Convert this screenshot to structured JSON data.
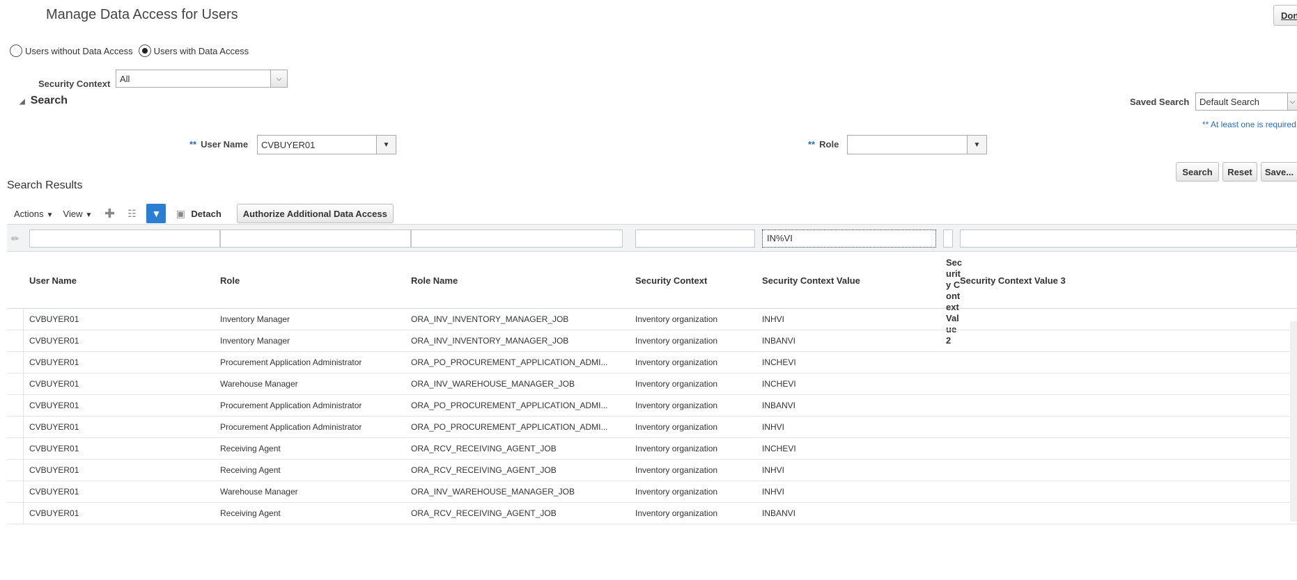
{
  "page": {
    "title": "Manage Data Access for Users",
    "done_label": "Done"
  },
  "mode": {
    "options": [
      {
        "label": "Users without Data Access",
        "selected": false
      },
      {
        "label": "Users with Data Access",
        "selected": true
      }
    ]
  },
  "security_context": {
    "label": "Security Context",
    "value": "All"
  },
  "search": {
    "title": "Search",
    "saved_search_label": "Saved Search",
    "saved_search_value": "Default Search",
    "required_hint": "** At least one is required",
    "required_marker": "**",
    "user_name_label": "User Name",
    "user_name_value": "CVBUYER01",
    "role_label": "Role",
    "role_value": "",
    "buttons": {
      "search": "Search",
      "reset": "Reset",
      "save": "Save..."
    }
  },
  "results": {
    "title": "Search Results",
    "toolbar": {
      "actions": "Actions",
      "view": "View",
      "detach": "Detach",
      "authorize": "Authorize Additional Data Access"
    },
    "filters": {
      "user_name": "",
      "role": "",
      "role_name": "",
      "security_context": "",
      "security_context_value": "IN%VI",
      "security_context_value_2": "",
      "security_context_value_3": ""
    },
    "columns": {
      "user_name": "User Name",
      "role": "Role",
      "role_name": "Role Name",
      "security_context": "Security Context",
      "security_context_value": "Security Context Value",
      "security_context_value_2": "Security Context Value 2",
      "security_context_value_3": "Security Context Value 3"
    },
    "rows": [
      {
        "user": "CVBUYER01",
        "role": "Inventory Manager",
        "role_name": "ORA_INV_INVENTORY_MANAGER_JOB",
        "context": "Inventory organization",
        "value": "INHVI"
      },
      {
        "user": "CVBUYER01",
        "role": "Inventory Manager",
        "role_name": "ORA_INV_INVENTORY_MANAGER_JOB",
        "context": "Inventory organization",
        "value": "INBANVI"
      },
      {
        "user": "CVBUYER01",
        "role": "Procurement Application Administrator",
        "role_name": "ORA_PO_PROCUREMENT_APPLICATION_ADMI...",
        "context": "Inventory organization",
        "value": "INCHEVI"
      },
      {
        "user": "CVBUYER01",
        "role": "Warehouse Manager",
        "role_name": "ORA_INV_WAREHOUSE_MANAGER_JOB",
        "context": "Inventory organization",
        "value": "INCHEVI"
      },
      {
        "user": "CVBUYER01",
        "role": "Procurement Application Administrator",
        "role_name": "ORA_PO_PROCUREMENT_APPLICATION_ADMI...",
        "context": "Inventory organization",
        "value": "INBANVI"
      },
      {
        "user": "CVBUYER01",
        "role": "Procurement Application Administrator",
        "role_name": "ORA_PO_PROCUREMENT_APPLICATION_ADMI...",
        "context": "Inventory organization",
        "value": "INHVI"
      },
      {
        "user": "CVBUYER01",
        "role": "Receiving Agent",
        "role_name": "ORA_RCV_RECEIVING_AGENT_JOB",
        "context": "Inventory organization",
        "value": "INCHEVI"
      },
      {
        "user": "CVBUYER01",
        "role": "Receiving Agent",
        "role_name": "ORA_RCV_RECEIVING_AGENT_JOB",
        "context": "Inventory organization",
        "value": "INHVI"
      },
      {
        "user": "CVBUYER01",
        "role": "Warehouse Manager",
        "role_name": "ORA_INV_WAREHOUSE_MANAGER_JOB",
        "context": "Inventory organization",
        "value": "INHVI"
      },
      {
        "user": "CVBUYER01",
        "role": "Receiving Agent",
        "role_name": "ORA_RCV_RECEIVING_AGENT_JOB",
        "context": "Inventory organization",
        "value": "INBANVI"
      }
    ]
  },
  "colors": {
    "accent": "#2a7fd4",
    "hint": "#2a6ebb"
  }
}
